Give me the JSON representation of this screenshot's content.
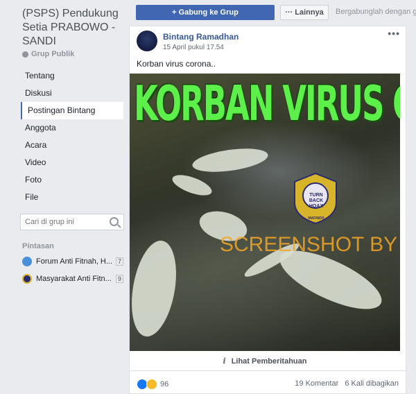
{
  "group": {
    "title": "(PSPS) Pendukung Setia PRABOWO - SANDI",
    "type": "Grup Publik"
  },
  "nav": {
    "items": [
      "Tentang",
      "Diskusi",
      "Postingan Bintang",
      "Anggota",
      "Acara",
      "Video",
      "Foto",
      "File"
    ],
    "active_index": 2
  },
  "search": {
    "placeholder": "Cari di grup ini"
  },
  "shortcuts": {
    "heading": "Pintasan",
    "items": [
      {
        "label": "Forum Anti Fitnah, H...",
        "count": "7"
      },
      {
        "label": "Masyarakat Anti Fitn...",
        "count": "9"
      }
    ]
  },
  "topbar": {
    "join_label": "+ Gabung ke Grup",
    "more_label": "··· Lainnya",
    "invite_text": "Bergabunglah dengan grup"
  },
  "post": {
    "author": "Bintang Ramadhan",
    "timestamp": "15 April pukul 17.54",
    "text": "Korban virus corona..",
    "image_headline": "KORBAN VIRUS CORONA",
    "watermark": "SCREENSHOT BY",
    "badge_top": "TURN BACK HOAX",
    "badge_bottom": "MAFINDO",
    "notice": "Lihat Pemberitahuan",
    "reactions_count": "96",
    "comments": "19 Komentar",
    "shares": "6 Kali dibagikan"
  },
  "colors": {
    "brand": "#4267b2",
    "link": "#385898",
    "headline_green": "#5df04b",
    "watermark_orange": "#f5a623"
  }
}
